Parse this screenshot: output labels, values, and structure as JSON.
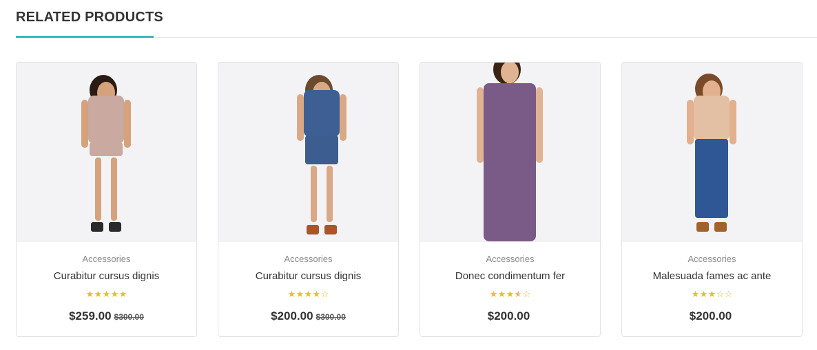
{
  "section": {
    "title": "RELATED PRODUCTS"
  },
  "colors": {
    "accent": "#3bb4b8",
    "star": "#f2b81c",
    "border": "#e3e3e3"
  },
  "products": [
    {
      "category": "Accessories",
      "name": "Curabitur cursus dignis",
      "rating": 5,
      "price": "$259.00",
      "old_price": "$300.00",
      "image": {
        "top": "#c9a9a0",
        "bottom": "#c9a9a0",
        "skin": "#d6a27c",
        "hair": "#2a1c14",
        "shoes": "#2a2a2a",
        "desc_icon": "woman-floral-romper-image"
      }
    },
    {
      "category": "Accessories",
      "name": "Curabitur cursus dignis",
      "rating": 4,
      "price": "$200.00",
      "old_price": "$300.00",
      "image": {
        "top": "#3d5f93",
        "bottom": "#3b5d90",
        "skin": "#d9a985",
        "hair": "#6b4a2e",
        "shoes": "#a8552a",
        "desc_icon": "woman-denim-dress-image"
      }
    },
    {
      "category": "Accessories",
      "name": "Donec condimentum fer",
      "rating": 3.5,
      "price": "$200.00",
      "old_price": "",
      "image": {
        "top": "#7a5a86",
        "bottom": "#b59ab8",
        "skin": "#e0b392",
        "hair": "#3a2416",
        "shoes": "#222222",
        "desc_icon": "woman-paisley-kimono-image"
      }
    },
    {
      "category": "Accessories",
      "name": "Malesuada fames ac ante",
      "rating": 3,
      "price": "$200.00",
      "old_price": "",
      "image": {
        "top": "#e3bfa3",
        "bottom": "#2f5795",
        "skin": "#e2b08c",
        "hair": "#7a4a2a",
        "shoes": "#a1622c",
        "desc_icon": "woman-denim-culottes-image"
      }
    }
  ]
}
